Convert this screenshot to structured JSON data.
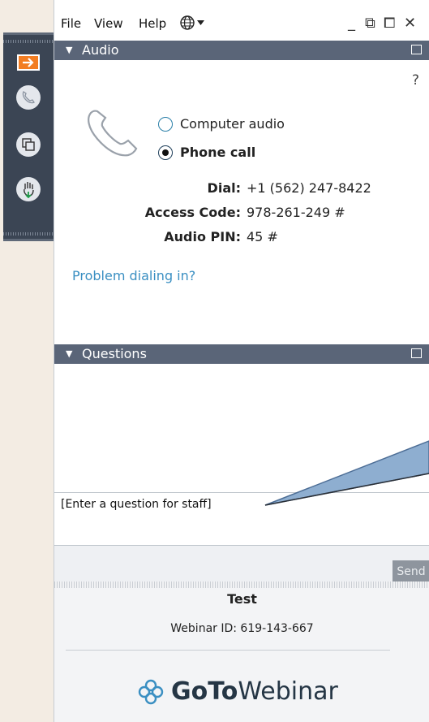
{
  "menu": {
    "file": "File",
    "view": "View",
    "help": "Help"
  },
  "window_controls": {
    "minimize": "_",
    "restore": "⧉",
    "popout": "⧠",
    "close": "✕"
  },
  "audio": {
    "section_title": "Audio",
    "help_glyph": "?",
    "options": [
      {
        "label": "Computer audio",
        "selected": false
      },
      {
        "label": "Phone call",
        "selected": true
      }
    ],
    "dial_label": "Dial:",
    "dial_value": "+1 (562) 247-8422",
    "access_label": "Access Code:",
    "access_value": "978-261-249 #",
    "pin_label": "Audio PIN:",
    "pin_value": "45 #",
    "problem_link": "Problem dialing in?"
  },
  "questions": {
    "section_title": "Questions",
    "input_placeholder": "[Enter a question for staff]",
    "send_label": "Send"
  },
  "footer": {
    "title": "Test",
    "webinar_id": "Webinar ID: 619-143-667",
    "logo_bold": "GoTo",
    "logo_light": "Webinar"
  },
  "colors": {
    "accent_orange": "#f27d22",
    "header_bar": "#5a6578",
    "toolbar": "#3b4554",
    "link": "#3a8fc2"
  }
}
